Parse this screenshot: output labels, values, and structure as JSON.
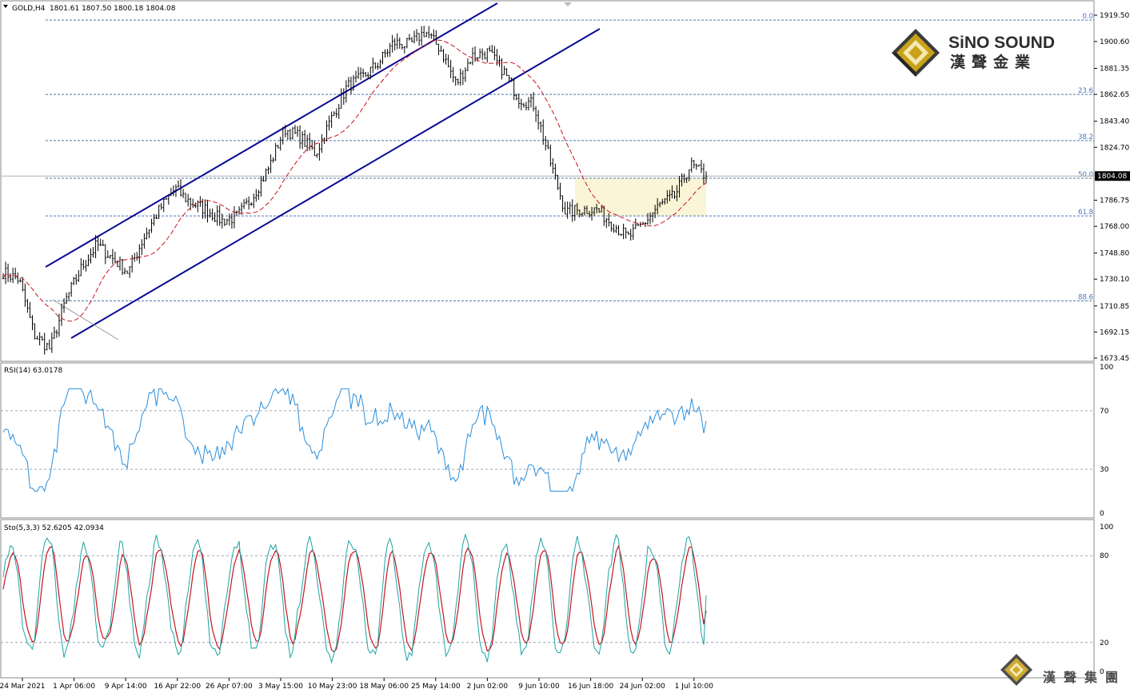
{
  "header": {
    "symbol_label": "GOLD,H4",
    "ohlc": "1801.61 1807.50 1800.18 1804.08",
    "collapse_icon": "triangle-down-icon"
  },
  "logo": {
    "name_en": "SiNO SOUND",
    "name_zh": "漢聲金業",
    "watermark_zh": "漢聲集團",
    "emblem_icon": "diamond-emblem-icon",
    "colors": {
      "gold": "#c9a21a",
      "dark": "#3b3b3b",
      "light": "#f4e7b0"
    }
  },
  "colors": {
    "candle": "#000000",
    "ma": "#c8141e",
    "channel": "#0a0a96",
    "fib": "#4a76b8",
    "grid": "#9aa6b8",
    "rsi": "#2b8fdc",
    "sto_main": "#1fa3a3",
    "sto_signal": "#c8141e",
    "zone": "#fbf5d7",
    "current_price_line": "#b0b0b0"
  },
  "price_axis": {
    "labels": [
      "1919.50",
      "1900.60",
      "1881.35",
      "1862.65",
      "1843.40",
      "1824.70",
      "1786.75",
      "1768.00",
      "1748.80",
      "1730.10",
      "1710.85",
      "1692.15",
      "1673.45"
    ],
    "current_price": "1804.08"
  },
  "time_axis": {
    "labels": [
      "24 Mar 2021",
      "1 Apr 06:00",
      "9 Apr 14:00",
      "16 Apr 22:00",
      "26 Apr 07:00",
      "3 May 15:00",
      "10 May 23:00",
      "18 May 06:00",
      "25 May 14:00",
      "2 Jun 02:00",
      "9 Jun 10:00",
      "16 Jun 18:00",
      "24 Jun 02:00",
      "1 Jul 10:00"
    ]
  },
  "chart_data": [
    {
      "type": "candlestick",
      "title": "GOLD,H4",
      "ylim": [
        1665,
        1925
      ],
      "ohlc_last": {
        "open": 1801.61,
        "high": 1807.5,
        "low": 1800.18,
        "close": 1804.08
      },
      "price_path": [
        {
          "x": "24 Mar 2021",
          "y": 1735
        },
        {
          "x": "27 Mar",
          "y": 1730
        },
        {
          "x": "29 Mar",
          "y": 1690
        },
        {
          "x": "31 Mar",
          "y": 1680
        },
        {
          "x": "1 Apr 06:00",
          "y": 1715
        },
        {
          "x": "6 Apr",
          "y": 1738
        },
        {
          "x": "8 Apr",
          "y": 1755
        },
        {
          "x": "9 Apr 14:00",
          "y": 1745
        },
        {
          "x": "12 Apr",
          "y": 1735
        },
        {
          "x": "14 Apr",
          "y": 1760
        },
        {
          "x": "16 Apr 22:00",
          "y": 1780
        },
        {
          "x": "20 Apr",
          "y": 1795
        },
        {
          "x": "22 Apr",
          "y": 1785
        },
        {
          "x": "26 Apr 07:00",
          "y": 1780
        },
        {
          "x": "28 Apr",
          "y": 1772
        },
        {
          "x": "30 Apr",
          "y": 1775
        },
        {
          "x": "3 May 15:00",
          "y": 1790
        },
        {
          "x": "5 May",
          "y": 1810
        },
        {
          "x": "7 May",
          "y": 1838
        },
        {
          "x": "10 May 23:00",
          "y": 1832
        },
        {
          "x": "12 May",
          "y": 1820
        },
        {
          "x": "14 May",
          "y": 1845
        },
        {
          "x": "18 May 06:00",
          "y": 1868
        },
        {
          "x": "20 May",
          "y": 1875
        },
        {
          "x": "22 May",
          "y": 1885
        },
        {
          "x": "25 May 14:00",
          "y": 1900
        },
        {
          "x": "27 May",
          "y": 1898
        },
        {
          "x": "29 May",
          "y": 1908
        },
        {
          "x": "2 Jun 02:00",
          "y": 1895
        },
        {
          "x": "3 Jun",
          "y": 1870
        },
        {
          "x": "5 Jun",
          "y": 1890
        },
        {
          "x": "9 Jun 10:00",
          "y": 1893
        },
        {
          "x": "11 Jun",
          "y": 1880
        },
        {
          "x": "14 Jun",
          "y": 1860
        },
        {
          "x": "16 Jun",
          "y": 1855
        },
        {
          "x": "16 Jun 18:00",
          "y": 1815
        },
        {
          "x": "17 Jun",
          "y": 1778
        },
        {
          "x": "20 Jun",
          "y": 1780
        },
        {
          "x": "24 Jun 02:00",
          "y": 1780
        },
        {
          "x": "28 Jun",
          "y": 1770
        },
        {
          "x": "29 Jun",
          "y": 1760
        },
        {
          "x": "30 Jun",
          "y": 1770
        },
        {
          "x": "1 Jul 10:00",
          "y": 1783
        },
        {
          "x": "2 Jul",
          "y": 1790
        },
        {
          "x": "5 Jul",
          "y": 1812
        },
        {
          "x": "6 Jul",
          "y": 1804.08
        }
      ],
      "fibonacci_levels": [
        {
          "label": "0.0",
          "price": 1916
        },
        {
          "label": "23.6",
          "price": 1862.65
        },
        {
          "label": "38.2",
          "price": 1829.5
        },
        {
          "label": "50.0",
          "price": 1802.5
        },
        {
          "label": "61.8",
          "price": 1775.5
        },
        {
          "label": "88.6",
          "price": 1714.5
        }
      ],
      "moving_average": "red dashed",
      "consolidation_zone": {
        "x_start": "16 Jun 18:00",
        "x_end": "6 Jul",
        "y_low": 1775.5,
        "y_high": 1802.5
      },
      "grid": false
    },
    {
      "type": "line",
      "title": "RSI(14) 63.0178",
      "ylim": [
        0,
        100
      ],
      "y_ticks": [
        "100",
        "70",
        "30",
        "0"
      ],
      "last_value": 63.0178
    },
    {
      "type": "line",
      "title": "Sto(5,3,3) 52.6205 42.0934",
      "ylim": [
        0,
        100
      ],
      "y_ticks": [
        "100",
        "80",
        "20",
        "0"
      ],
      "last_values": [
        52.6205,
        42.0934
      ]
    }
  ],
  "rsi": {
    "label": "RSI(14) 63.0178",
    "ticks": [
      "100",
      "70",
      "30",
      "0"
    ]
  },
  "sto": {
    "label": "Sto(5,3,3) 52.6205 42.0934",
    "ticks": [
      "100",
      "80",
      "20",
      "0"
    ]
  }
}
